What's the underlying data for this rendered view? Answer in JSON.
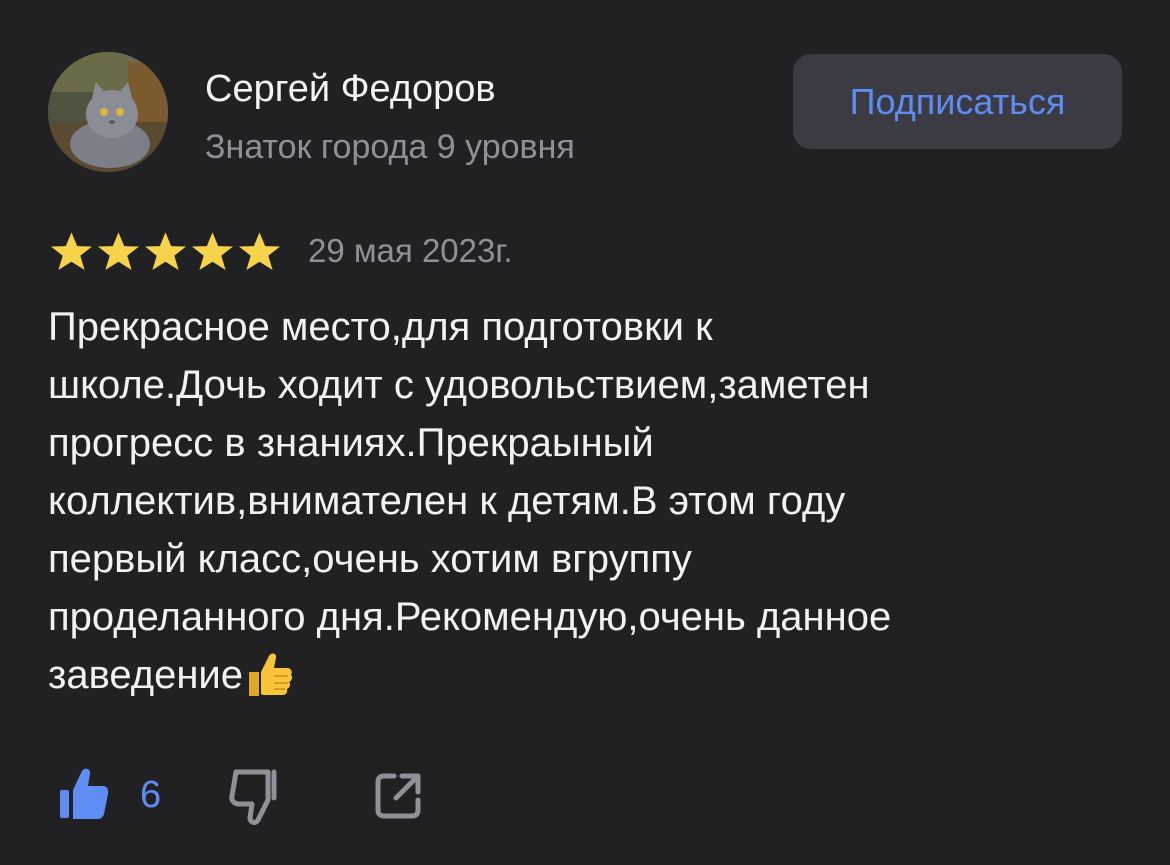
{
  "author": {
    "name": "Сергей Федоров",
    "level": "Знаток города 9 уровня",
    "avatar_icon": "cat-avatar"
  },
  "subscribe": {
    "label": "Подписаться"
  },
  "review": {
    "rating": 5,
    "rating_max": 5,
    "date": "29 мая 2023г.",
    "lines": [
      "Прекрасное место,для подготовки к",
      "школе.Дочь ходит с удовольствием,заметен",
      "прогресс в знаниях.Прекраыный",
      "коллектив,внимателен к детям.В этом году",
      "первый класс,очень хотим вгруппу",
      "проделанного дня.Рекомендую,очень данное",
      "заведение"
    ],
    "end_emoji_icon": "thumbs-up-emoji"
  },
  "actions": {
    "likes_count": "6",
    "like_icon": "thumbs-up-icon",
    "dislike_icon": "thumbs-down-icon",
    "share_icon": "share-icon"
  },
  "colors": {
    "background": "#212124",
    "accent": "#5f8cf5",
    "star": "#f6d34b",
    "secondary_text": "#8f9098",
    "button_bg": "#3b3c43"
  }
}
